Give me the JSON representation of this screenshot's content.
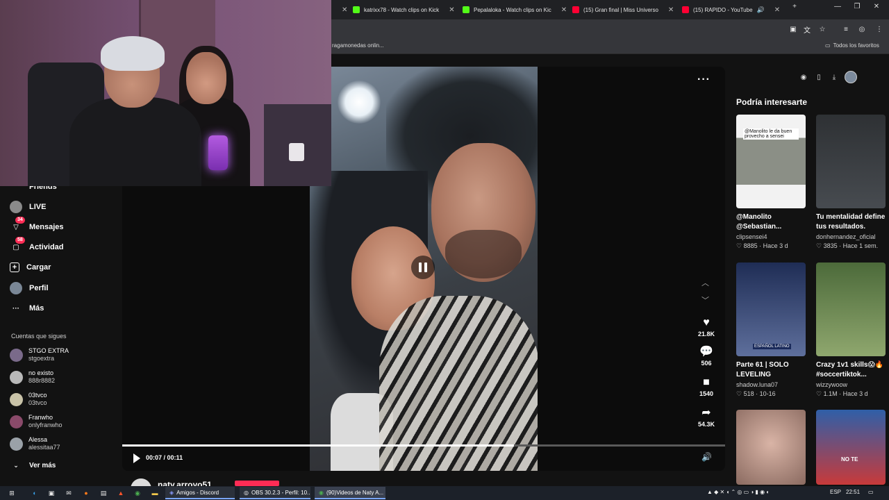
{
  "browser": {
    "tabs": [
      {
        "label": "katrixx78 - Watch clips on Kick",
        "icon": "kick-icon",
        "color": "#53fc18"
      },
      {
        "label": "Pepalaloka - Watch clips on Kic",
        "icon": "kick-icon",
        "color": "#53fc18"
      },
      {
        "label": "(15) Gran final | Miss Universo",
        "icon": "youtube-icon",
        "color": "#ff0033"
      },
      {
        "label": "(15) RAPIDO - YouTube",
        "icon": "youtube-icon",
        "color": "#ff0033"
      }
    ],
    "bookmark_left": "ragamonedas onlin...",
    "bookmark_right": "Todos los favoritos"
  },
  "sidebar": {
    "partial_item": "Friends",
    "items": [
      {
        "label": "LIVE",
        "icon": "live-icon",
        "badge": ""
      },
      {
        "label": "Mensajes",
        "icon": "message-icon",
        "badge": "34"
      },
      {
        "label": "Actividad",
        "icon": "activity-icon",
        "badge": "58"
      },
      {
        "label": "Cargar",
        "icon": "upload-icon",
        "badge": ""
      },
      {
        "label": "Perfil",
        "icon": "profile-icon",
        "badge": ""
      },
      {
        "label": "Más",
        "icon": "more-icon",
        "badge": ""
      }
    ],
    "following_heading": "Cuentas que sigues",
    "following": [
      {
        "name": "STGO EXTRA",
        "handle": "stgoextra",
        "color": "#7a6a8a"
      },
      {
        "name": "no existo",
        "handle": "888r8882",
        "color": "#b9b9b9"
      },
      {
        "name": "03tvco",
        "handle": "03tvco",
        "color": "#c9c3a8"
      },
      {
        "name": "Franwho",
        "handle": "onlyfranwho",
        "color": "#8a4a6a"
      },
      {
        "name": "Alessa",
        "handle": "alessitaa77",
        "color": "#9aa1a8"
      }
    ],
    "see_more": "Ver más"
  },
  "video": {
    "current_time": "00:07",
    "duration": "00:11",
    "progress": 0.65,
    "likes": "21.8K",
    "comments": "506",
    "saves": "1540",
    "shares": "54.3K",
    "author": "naty.arroyo51"
  },
  "recommendations": {
    "title": "Podría interesarte",
    "items": [
      {
        "caption": "@Manolito @Sebastian...",
        "user": "clipsensei4",
        "likes": "8885",
        "age": "Hace 3 d",
        "thumb": "#e9e9e9",
        "overlay": "@Manolito le da buen provecho a sensei"
      },
      {
        "caption": "Tu mentalidad define tus resultados. ¿Qu...",
        "user": "donhernandez_oficial",
        "likes": "3835",
        "age": "Hace 1 sem.",
        "thumb": "#3a3d40",
        "overlay": ""
      },
      {
        "caption": "Parte 61 | SOLO LEVELING ESPAÑO...",
        "user": "shadow.luna07",
        "likes": "518",
        "age": "10-16",
        "thumb": "#3d4f7a",
        "overlay": "ESPAÑOL LATINO"
      },
      {
        "caption": "Crazy 1v1 skills😱🔥 #soccertiktok...",
        "user": "wizzywoow",
        "likes": "1.1M",
        "age": "Hace 3 d",
        "thumb": "#6f8a5a",
        "overlay": ""
      },
      {
        "caption": "",
        "user": "",
        "likes": "",
        "age": "",
        "thumb": "#c9a79a",
        "overlay": ""
      },
      {
        "caption": "",
        "user": "",
        "likes": "",
        "age": "",
        "thumb": "#2f5fa8",
        "overlay": "NO TE"
      }
    ]
  },
  "taskbar": {
    "apps": [
      {
        "label": "Amigos - Discord",
        "icon": "discord-icon"
      },
      {
        "label": "OBS 30.2.3 - Perfil: 10...",
        "icon": "obs-icon"
      },
      {
        "label": "(90)Videos de Naty A...",
        "icon": "chrome-icon"
      }
    ],
    "language": "ESP",
    "time": "22:51"
  }
}
